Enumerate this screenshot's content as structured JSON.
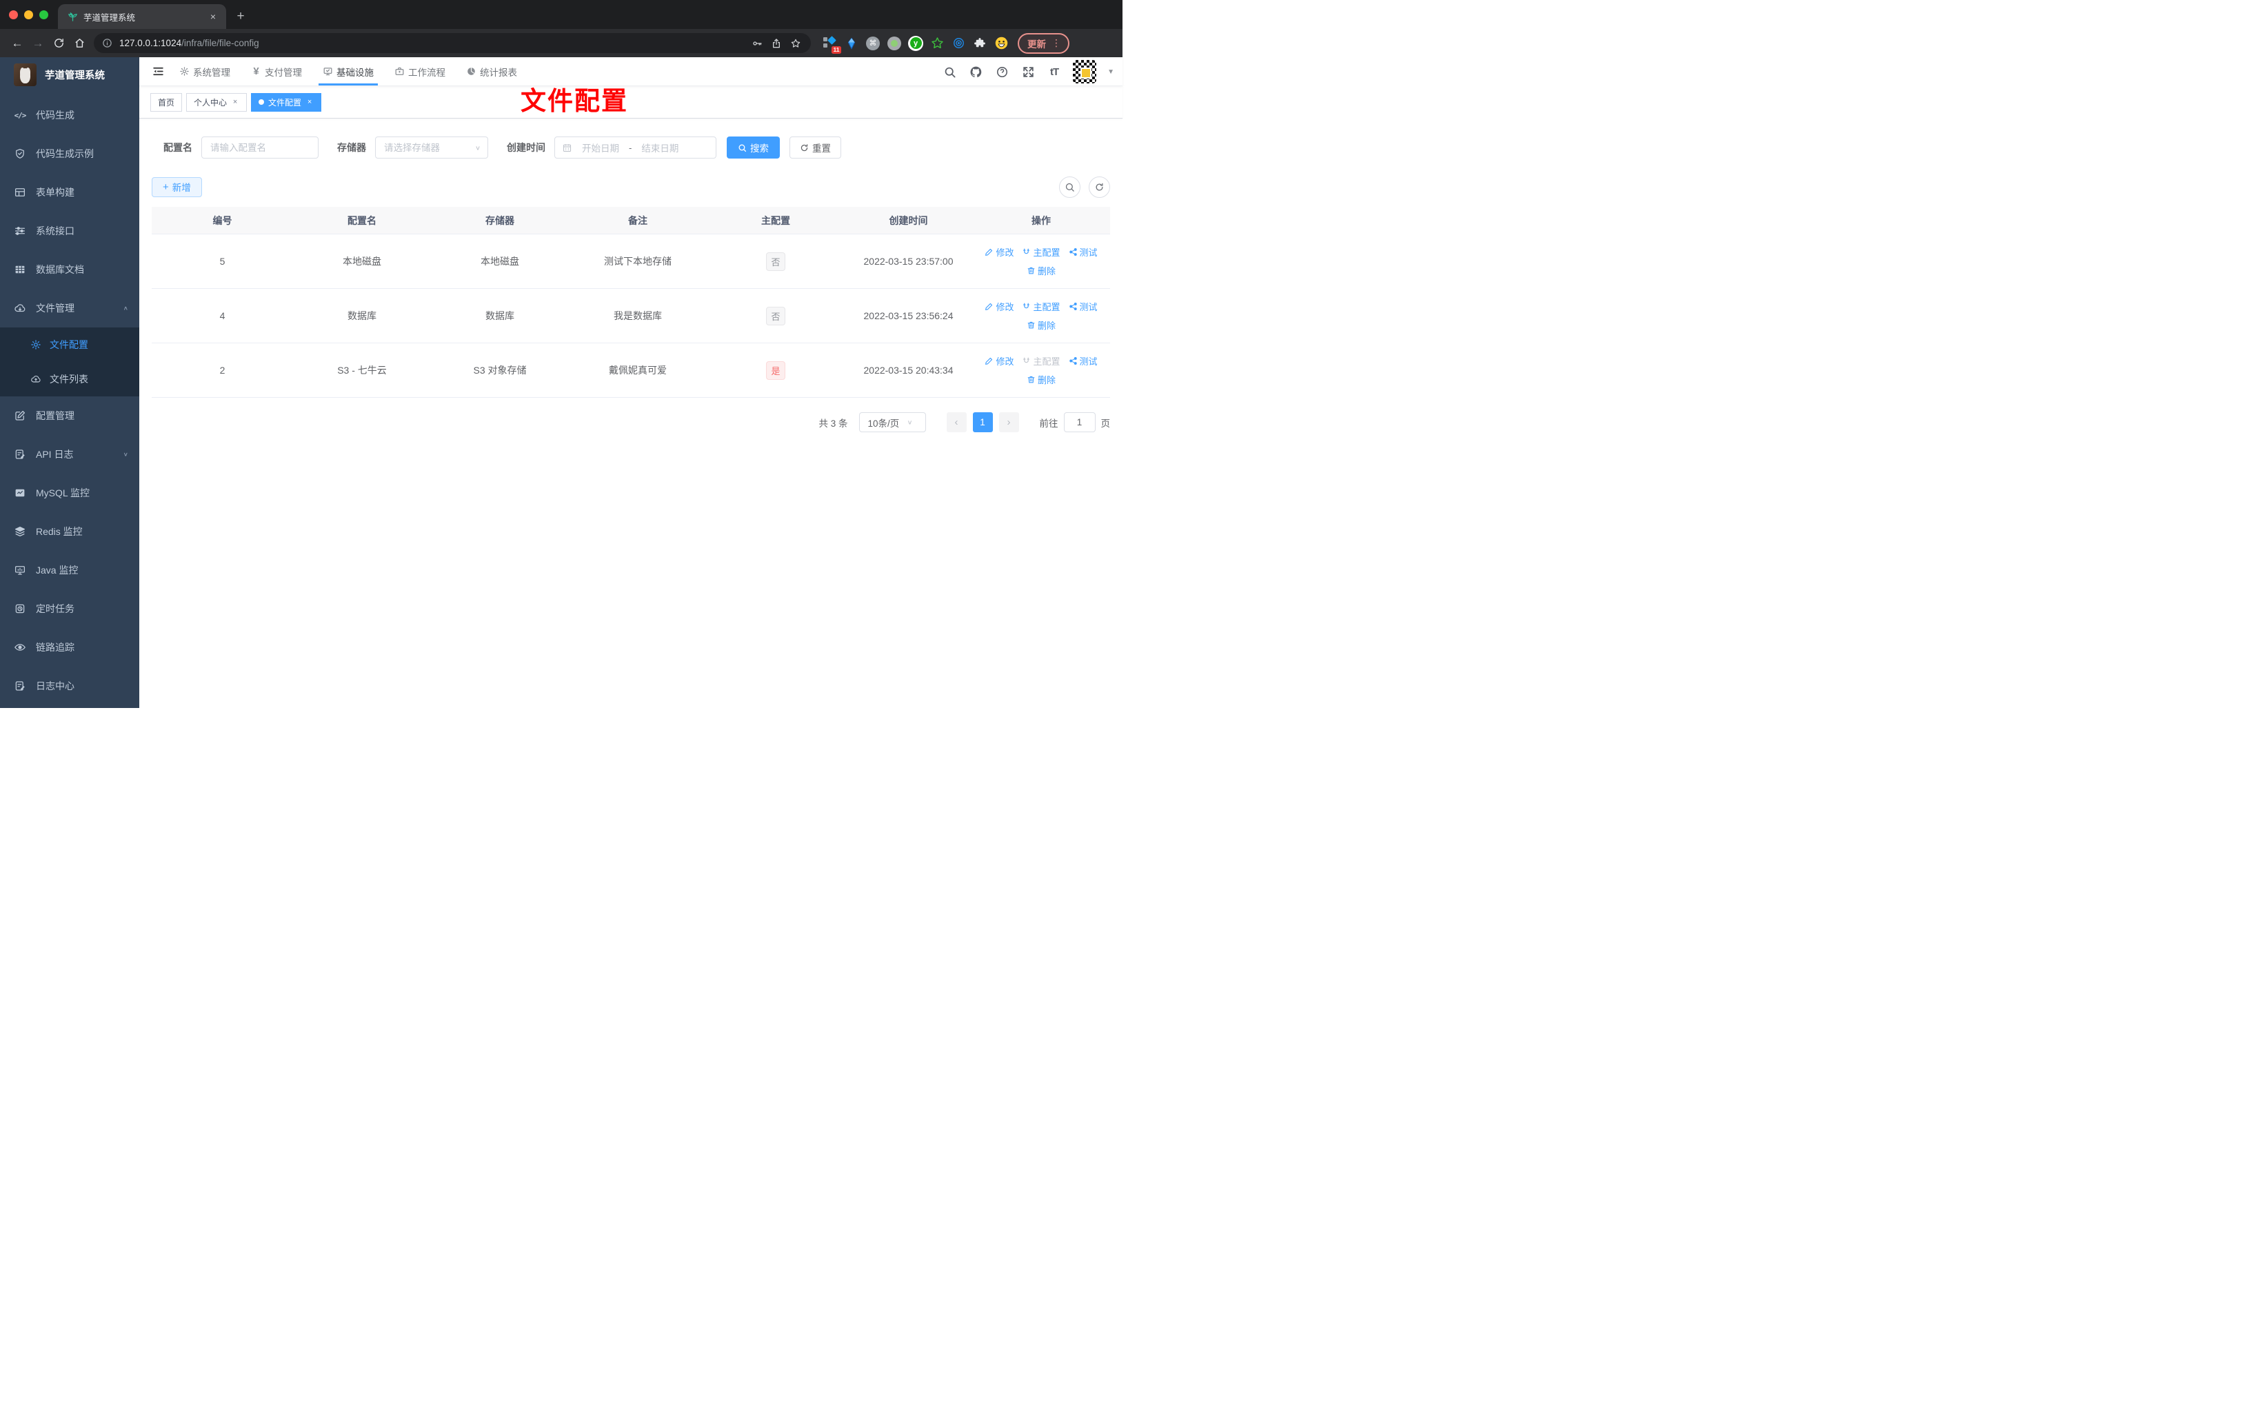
{
  "browser": {
    "tab_title": "芋道管理系统",
    "url_host": "127.0.0.1:1024",
    "url_path": "/infra/file/file-config",
    "extension_badge": "11",
    "update_button": "更新"
  },
  "glyphs": {
    "close": "×",
    "plus": "+",
    "dots": "⋮",
    "caret_up": "∧",
    "caret_down": "∨",
    "prev": "‹",
    "next": "›",
    "dropdown": "▼",
    "back": "←",
    "forward": "→",
    "cmd": "⌘",
    "help": "?",
    "yen": "¥",
    "font_size": "tT",
    "code": "</>",
    "letter_y": "y"
  },
  "sidebar": {
    "logo_title": "芋道管理系统",
    "items": [
      {
        "label": "代码生成"
      },
      {
        "label": "代码生成示例"
      },
      {
        "label": "表单构建"
      },
      {
        "label": "系统接口"
      },
      {
        "label": "数据库文档"
      },
      {
        "label": "文件管理"
      },
      {
        "label": "文件配置"
      },
      {
        "label": "文件列表"
      },
      {
        "label": "配置管理"
      },
      {
        "label": "API 日志"
      },
      {
        "label": "MySQL 监控"
      },
      {
        "label": "Redis 监控"
      },
      {
        "label": "Java 监控"
      },
      {
        "label": "定时任务"
      },
      {
        "label": "链路追踪"
      },
      {
        "label": "日志中心"
      }
    ]
  },
  "topnav": {
    "items": [
      {
        "label": "系统管理"
      },
      {
        "label": "支付管理"
      },
      {
        "label": "基础设施"
      },
      {
        "label": "工作流程"
      },
      {
        "label": "统计报表"
      }
    ]
  },
  "tags": {
    "items": [
      {
        "label": "首页"
      },
      {
        "label": "个人中心"
      },
      {
        "label": "文件配置"
      }
    ]
  },
  "annotation": "文件配置",
  "filters": {
    "name_label": "配置名",
    "name_placeholder": "请输入配置名",
    "storage_label": "存储器",
    "storage_placeholder": "请选择存储器",
    "time_label": "创建时间",
    "start_placeholder": "开始日期",
    "separator": "-",
    "end_placeholder": "结束日期",
    "search_label": "搜索",
    "reset_label": "重置",
    "add_label": "新增"
  },
  "table": {
    "headers": [
      "编号",
      "配置名",
      "存储器",
      "备注",
      "主配置",
      "创建时间",
      "操作"
    ],
    "action_labels": {
      "edit": "修改",
      "master": "主配置",
      "test": "测试",
      "delete": "删除"
    },
    "rows": [
      {
        "id": "5",
        "name": "本地磁盘",
        "storage": "本地磁盘",
        "remark": "测试下本地存储",
        "master": "否",
        "created": "2022-03-15 23:57:00"
      },
      {
        "id": "4",
        "name": "数据库",
        "storage": "数据库",
        "remark": "我是数据库",
        "master": "否",
        "created": "2022-03-15 23:56:24"
      },
      {
        "id": "2",
        "name": "S3 - 七牛云",
        "storage": "S3 对象存储",
        "remark": "戴佩妮真可爱",
        "master": "是",
        "created": "2022-03-15 20:43:34"
      }
    ]
  },
  "pagination": {
    "total": "共 3 条",
    "page_size": "10条/页",
    "current": "1",
    "goto_label": "前往",
    "goto_value": "1",
    "page_suffix": "页"
  },
  "colors": {
    "accent": "#409eff",
    "danger": "#f56c6c",
    "sidebar_bg": "#304156",
    "sidebar_sub_bg": "#1f2d3d",
    "annotation_red": "#fe0202"
  }
}
